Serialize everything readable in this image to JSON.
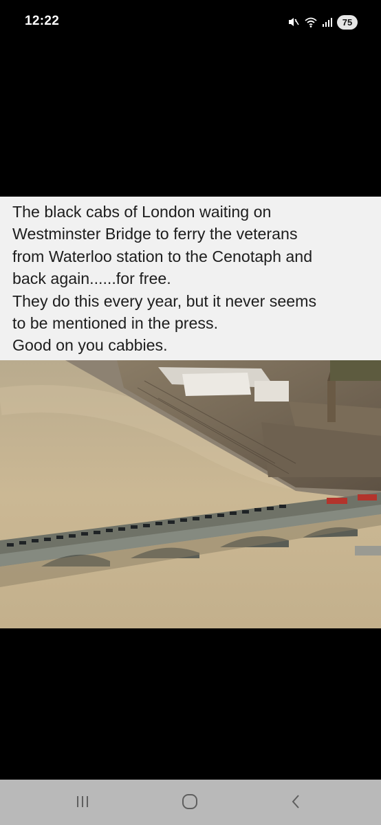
{
  "status_bar": {
    "time": "12:22",
    "icons": [
      "mute-icon",
      "wifi-icon",
      "signal-icon"
    ],
    "battery": "75"
  },
  "post": {
    "caption_lines": [
      "The black cabs of London waiting on",
      "Westminster Bridge to ferry the veterans",
      "from Waterloo station to the Cenotaph and",
      "back again......for free.",
      "They do this every year, but it never seems",
      "to be mentioned in the press.",
      "Good on you cabbies."
    ],
    "image": "aerial-photo-westminster-bridge"
  },
  "nav_bar": {
    "buttons": [
      "recent-apps-icon",
      "home-icon",
      "back-icon"
    ]
  },
  "colors": {
    "background": "#000000",
    "caption_bg": "#f1f1f1",
    "caption_text": "#1d1d1d",
    "nav_bg": "#b9b9b9",
    "river": "#cbb894"
  }
}
